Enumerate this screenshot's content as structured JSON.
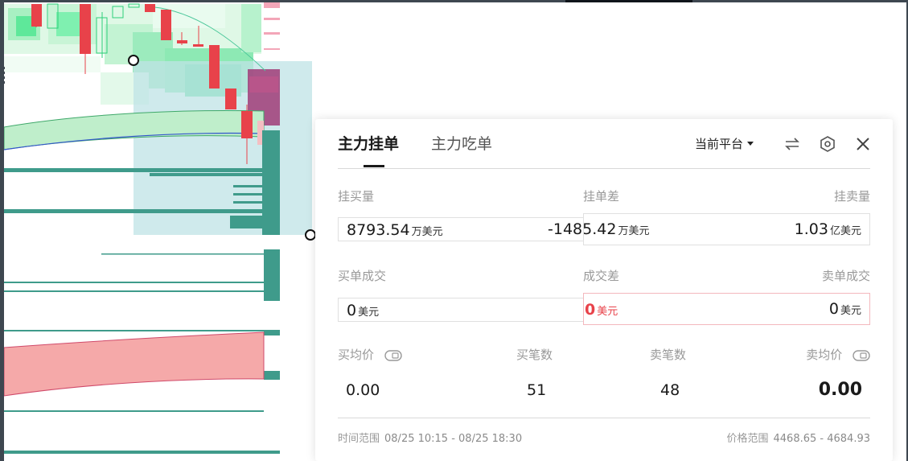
{
  "chart": {
    "colors": {
      "up": "#e8424a",
      "band_green": "#bfeecb",
      "band_red": "#f5a9a9",
      "teal": "#3f9b8b",
      "selection": "#c9e7ea",
      "blue_line": "#3355cc"
    }
  },
  "panel": {
    "tabs": [
      "主力挂单",
      "主力吃单"
    ],
    "platform_label": "当前平台",
    "icons": [
      "swap-icon",
      "settings-icon",
      "close-icon"
    ],
    "row1": {
      "buy_label": "挂买量",
      "diff_label": "挂单差",
      "sell_label": "挂卖量",
      "buy_value": "8793.54",
      "buy_unit": "万美元",
      "diff_value": "-1485.42",
      "diff_unit": "万美元",
      "sell_value": "1.03",
      "sell_unit": "亿美元"
    },
    "row2": {
      "buy_label": "买单成交",
      "diff_label": "成交差",
      "sell_label": "卖单成交",
      "buy_value": "0",
      "buy_unit": "美元",
      "diff_value": "0",
      "diff_unit": "美元",
      "sell_value": "0",
      "sell_unit": "美元"
    },
    "row3": {
      "buy_avg_label": "买均价",
      "buy_count_label": "买笔数",
      "sell_count_label": "卖笔数",
      "sell_avg_label": "卖均价",
      "buy_avg_value": "0.00",
      "buy_count_value": "51",
      "sell_count_value": "48",
      "sell_avg_value": "0.00"
    },
    "footer": {
      "time_label": "时间范围",
      "time_value": "08/25 10:15 - 08/25 18:30",
      "price_label": "价格范围",
      "price_value": "4468.65 - 4684.93"
    }
  }
}
